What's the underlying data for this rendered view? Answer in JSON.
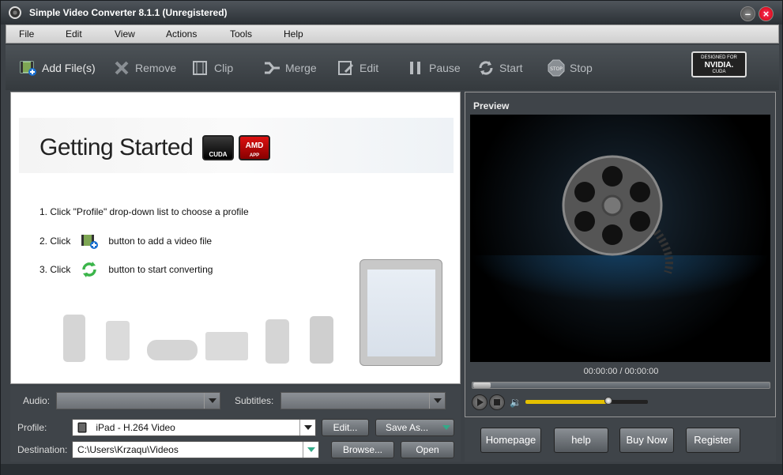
{
  "window": {
    "title": "Simple Video Converter 8.1.1 (Unregistered)"
  },
  "menu": [
    "File",
    "Edit",
    "View",
    "Actions",
    "Tools",
    "Help"
  ],
  "toolbar": {
    "add_files": "Add File(s)",
    "remove": "Remove",
    "clip": "Clip",
    "merge": "Merge",
    "edit": "Edit",
    "pause": "Pause",
    "start": "Start",
    "stop": "Stop",
    "nvidia_top": "DESIGNED FOR",
    "nvidia_brand": "NVIDIA.",
    "nvidia_sub": "CUDA"
  },
  "getting_started": {
    "title": "Getting Started",
    "cuda_badge": "CUDA",
    "amd_badge": "AMD",
    "amd_sub": "APP",
    "step1": "1. Click \"Profile\" drop-down list to choose a profile",
    "step2_prefix": "2. Click",
    "step2_suffix": "button to add a video file",
    "step3_prefix": "3. Click",
    "step3_suffix": "button to start converting"
  },
  "settings": {
    "audio_label": "Audio:",
    "audio_value": "",
    "subtitles_label": "Subtitles:",
    "subtitles_value": "",
    "profile_label": "Profile:",
    "profile_value": "iPad - H.264 Video",
    "edit_button": "Edit...",
    "save_as_button": "Save As...",
    "destination_label": "Destination:",
    "destination_value": "C:\\Users\\Krzaqu\\Videos",
    "browse_button": "Browse...",
    "open_button": "Open"
  },
  "preview": {
    "title": "Preview",
    "timecode": "00:00:00 / 00:00:00",
    "seek_fraction": 0.0,
    "volume_fraction": 0.68
  },
  "links": {
    "homepage": "Homepage",
    "help": "help",
    "buy_now": "Buy Now",
    "register": "Register"
  },
  "colors": {
    "accent_volume": "#e5c100",
    "close_button": "#d40010"
  }
}
